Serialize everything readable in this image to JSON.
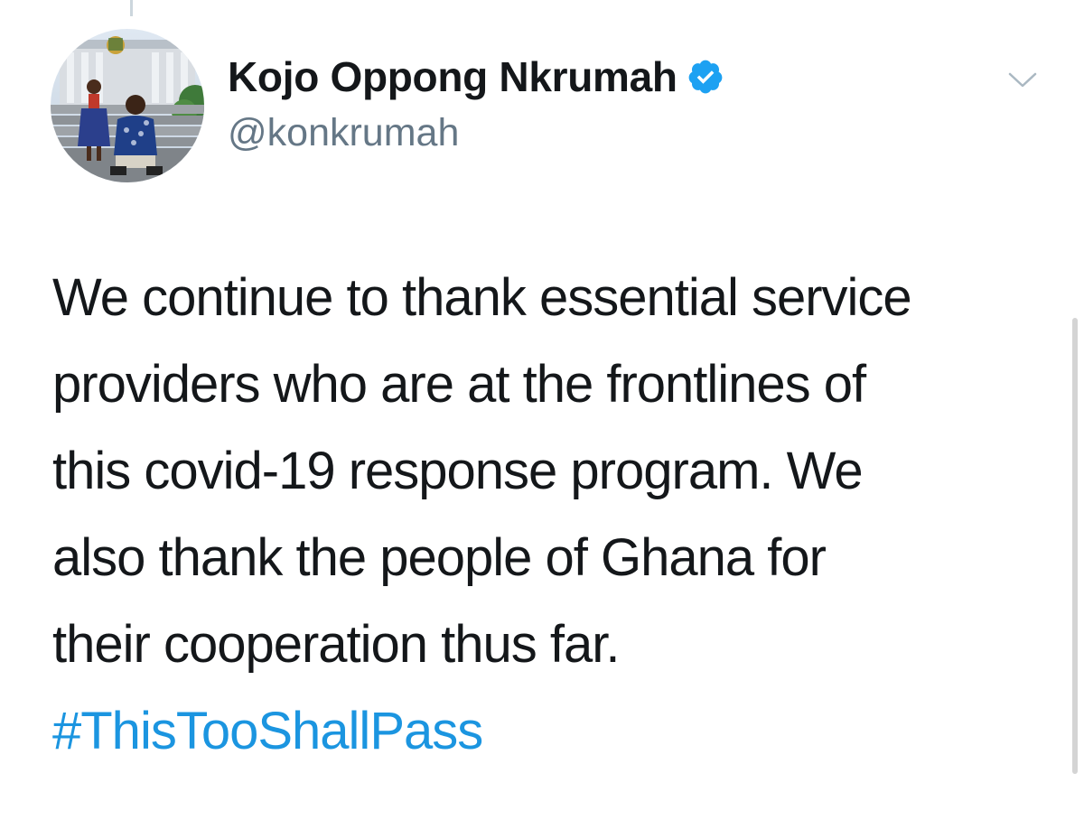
{
  "tweet": {
    "author": {
      "display_name": "Kojo Oppong Nkrumah",
      "handle": "@konkrumah",
      "verified": true,
      "avatar_icon": "profile-photo"
    },
    "text": "We continue to thank essential service\nproviders who are at the frontlines of\nthis  covid-19 response program. We\nalso thank the people of Ghana for\ntheir cooperation thus far.",
    "hashtag": "#ThisTooShallPass",
    "menu_icon": "chevron-down-icon"
  },
  "colors": {
    "text_primary": "#14171a",
    "text_secondary": "#657786",
    "link": "#1b95e0",
    "verified_badge": "#1da1f2",
    "thread_line": "#ccd6dd",
    "background": "#ffffff"
  }
}
